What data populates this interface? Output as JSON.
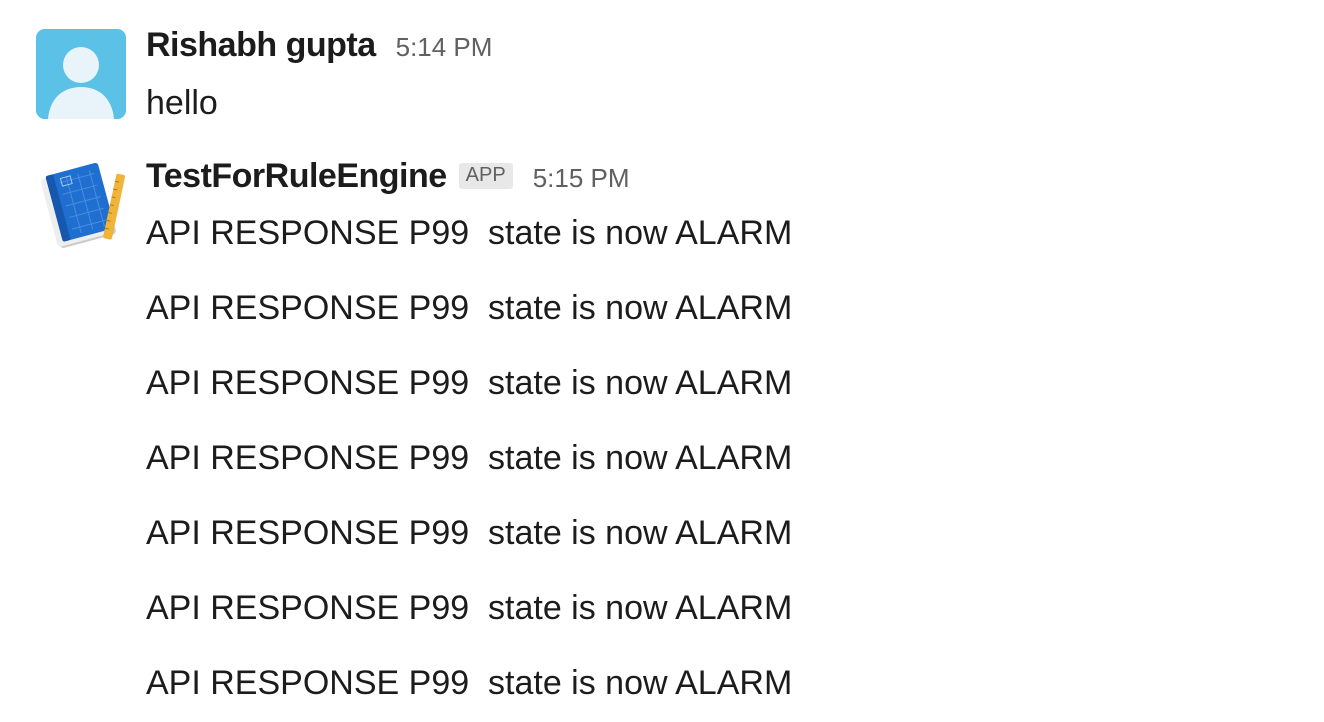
{
  "messages": [
    {
      "sender": "Rishabh gupta",
      "time": "5:14 PM",
      "avatar_icon": "default-user-avatar-icon",
      "lines": [
        "hello"
      ]
    },
    {
      "sender": "TestForRuleEngine",
      "badge": "APP",
      "time": "5:15 PM",
      "avatar_icon": "blueprint-book-icon",
      "lines": [
        "API RESPONSE P99  state is now ALARM",
        "API RESPONSE P99  state is now ALARM",
        "API RESPONSE P99  state is now ALARM",
        "API RESPONSE P99  state is now ALARM",
        "API RESPONSE P99  state is now ALARM",
        "API RESPONSE P99  state is now ALARM",
        "API RESPONSE P99  state is now ALARM"
      ]
    }
  ],
  "colors": {
    "user_avatar_bg": "#5bc1e6",
    "text": "#1d1c1d",
    "muted": "#616061",
    "badge_bg": "#e8e8e8"
  }
}
